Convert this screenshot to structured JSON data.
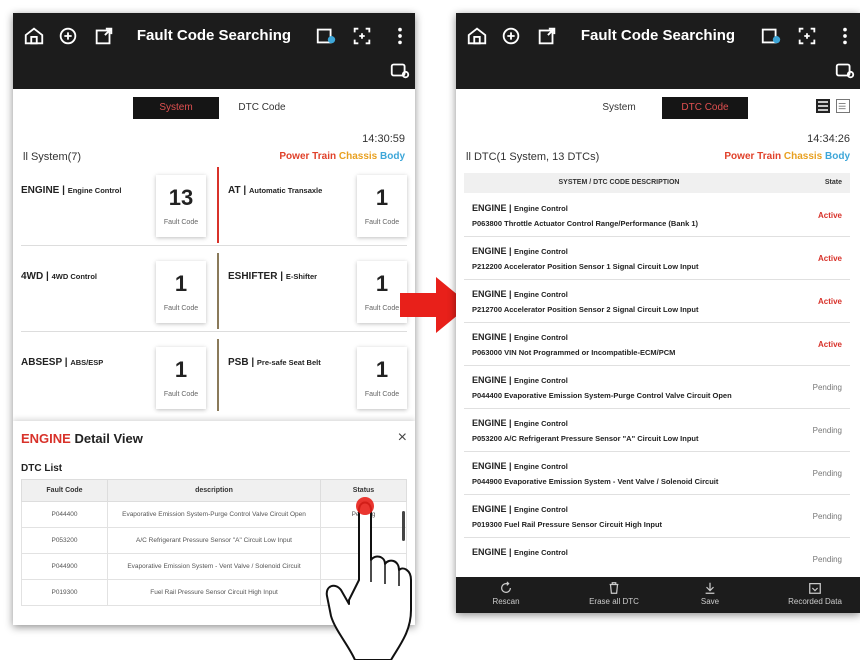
{
  "left": {
    "title": "Fault Code Searching",
    "tabs": [
      {
        "label": "System",
        "active": true
      },
      {
        "label": "DTC Code",
        "active": false
      }
    ],
    "time": "14:30:59",
    "system_count": "ll System(7)",
    "filters": {
      "power_train": "Power Train",
      "chassis": "Chassis",
      "body": "Body"
    },
    "systems": [
      {
        "name": "ENGINE",
        "desc": "Engine Control",
        "count": "13",
        "count_label": "Fault Code"
      },
      {
        "name": "AT",
        "desc": "Automatic Transaxle",
        "count": "1",
        "count_label": "Fault Code"
      },
      {
        "name": "4WD",
        "desc": "4WD Control",
        "count": "1",
        "count_label": "Fault Code"
      },
      {
        "name": "ESHIFTER",
        "desc": "E-Shifter",
        "count": "1",
        "count_label": "Fault Code"
      },
      {
        "name": "ABSESP",
        "desc": "ABS/ESP",
        "count": "1",
        "count_label": "Fault Code"
      },
      {
        "name": "PSB",
        "desc": "Pre-safe Seat Belt",
        "count": "1",
        "count_label": "Fault Code"
      }
    ],
    "detail": {
      "title_red": "ENGINE",
      "title_rest": "Detail View",
      "close": "×",
      "list_title": "DTC List",
      "columns": [
        "Fault Code",
        "description",
        "Status"
      ],
      "rows": [
        [
          "P044400",
          "Evaporative Emission System-Purge Control Valve Circuit Open",
          "Pending"
        ],
        [
          "P053200",
          "A/C Refrigerant Pressure Sensor \"A\" Circuit Low Input",
          "Pen"
        ],
        [
          "P044900",
          "Evaporative Emission System - Vent Valve / Solenoid Circuit",
          "Pe"
        ],
        [
          "P019300",
          "Fuel Rail Pressure Sensor Circuit High Input",
          ""
        ]
      ]
    }
  },
  "right": {
    "title": "Fault Code Searching",
    "tabs": [
      {
        "label": "System",
        "active": false
      },
      {
        "label": "DTC Code",
        "active": true
      }
    ],
    "time": "14:34:26",
    "dtc_count": "ll DTC(1 System, 13 DTCs)",
    "filters": {
      "power_train": "Power Train",
      "chassis": "Chassis",
      "body": "Body"
    },
    "columns": [
      "SYSTEM / DTC CODE DESCRIPTION",
      "State"
    ],
    "rows": [
      {
        "sys": "ENGINE",
        "sub": "Engine Control",
        "desc": "P063800 Throttle Actuator Control Range/Performance (Bank 1)",
        "state": "Active"
      },
      {
        "sys": "ENGINE",
        "sub": "Engine Control",
        "desc": "P212200 Accelerator Position Sensor 1 Signal Circuit Low Input",
        "state": "Active"
      },
      {
        "sys": "ENGINE",
        "sub": "Engine Control",
        "desc": "P212700 Accelerator Position Sensor 2 Signal Circuit Low Input",
        "state": "Active"
      },
      {
        "sys": "ENGINE",
        "sub": "Engine Control",
        "desc": "P063000 VIN Not Programmed or Incompatible-ECM/PCM",
        "state": "Active"
      },
      {
        "sys": "ENGINE",
        "sub": "Engine Control",
        "desc": "P044400 Evaporative Emission System-Purge Control Valve Circuit Open",
        "state": "Pending"
      },
      {
        "sys": "ENGINE",
        "sub": "Engine Control",
        "desc": "P053200 A/C Refrigerant Pressure Sensor \"A\" Circuit Low Input",
        "state": "Pending"
      },
      {
        "sys": "ENGINE",
        "sub": "Engine Control",
        "desc": "P044900 Evaporative Emission System - Vent Valve / Solenoid Circuit",
        "state": "Pending"
      },
      {
        "sys": "ENGINE",
        "sub": "Engine Control",
        "desc": "P019300 Fuel Rail Pressure Sensor Circuit High Input",
        "state": "Pending"
      },
      {
        "sys": "ENGINE",
        "sub": "Engine Control",
        "desc": "",
        "state": "Pending"
      }
    ],
    "bottom": [
      "Rescan",
      "Erase all DTC",
      "Save",
      "Recorded Data"
    ]
  },
  "colors": {
    "power_train": "#e0412a",
    "chassis": "#e8a020",
    "body": "#3da6d8",
    "active": "#d8322a",
    "arrow": "#e8201a"
  }
}
